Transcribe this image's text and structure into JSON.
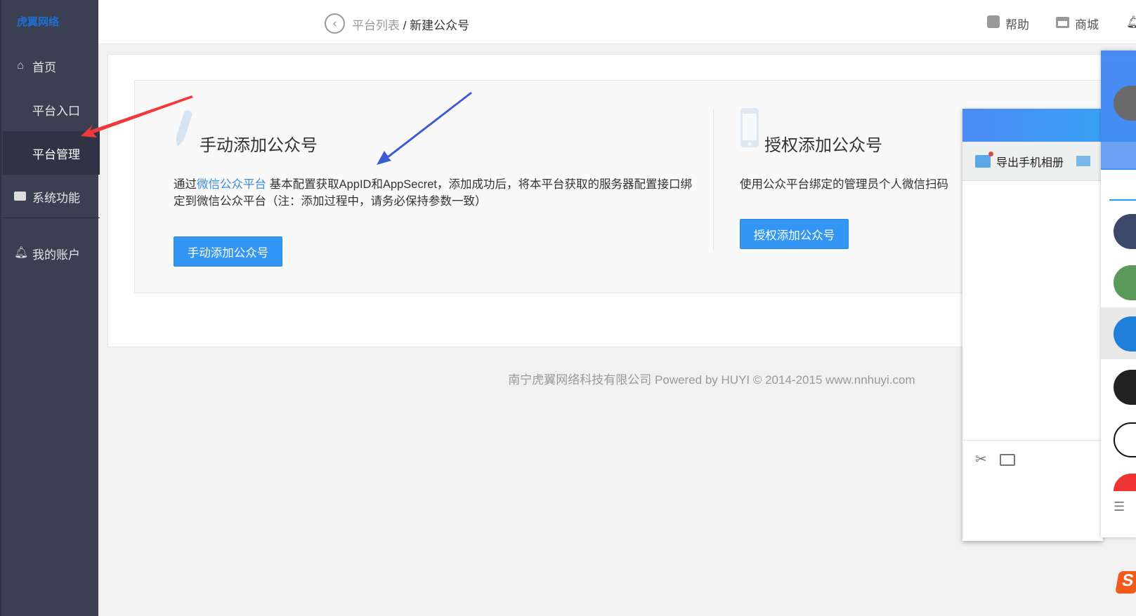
{
  "brand": {
    "logo": "虎翼网络"
  },
  "sidebar": {
    "items": [
      {
        "label": "首页",
        "icon": "home-icon"
      },
      {
        "label": "平台入口",
        "icon": "grid-icon"
      },
      {
        "label": "平台管理",
        "icon": "grid-gear-icon",
        "active": true
      },
      {
        "label": "系统功能",
        "icon": "monitor-icon"
      },
      {
        "label": "我的账户",
        "icon": "bell-icon"
      }
    ]
  },
  "topbar": {
    "breadcrumb_parent": "平台列表",
    "separator": " / ",
    "breadcrumb_current": "新建公众号",
    "help": "帮助",
    "mall": "商城"
  },
  "manual": {
    "title": "手动添加公众号",
    "desc_prefix": "通过",
    "desc_link": "微信公众平台",
    "desc_rest": " 基本配置获取AppID和AppSecret，添加成功后，将本平台获取的服务器配置接口绑定到微信公众平台（注：添加过程中，请务必保持参数一致）",
    "button": "手动添加公众号"
  },
  "auth": {
    "title": "授权添加公众号",
    "desc": "使用公众平台绑定的管理员个人微信扫码",
    "button": "授权添加公众号"
  },
  "footer": "南宁虎翼网络科技有限公司 Powered by HUYI © 2014-2015 www.nnhuyi.com",
  "qq_popup": {
    "export_label": "导出手机相册"
  },
  "colors": {
    "sidebar": "#3a3f51",
    "accent": "#3396f5",
    "link": "#3a8ee6"
  }
}
